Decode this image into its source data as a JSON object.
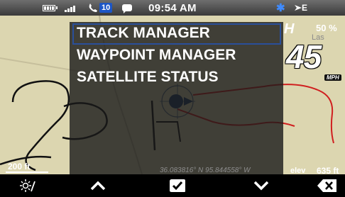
{
  "status_bar": {
    "battery_icon": "battery-icon",
    "signal_label": "atl",
    "missed_calls": "10",
    "time": "09:54 AM",
    "network": "E"
  },
  "menu": {
    "items": [
      "TRACK MANAGER",
      "WAYPOINT MANAGER",
      "SATELLITE STATUS"
    ],
    "selected_index": 0
  },
  "right_panel": {
    "heading": "H",
    "zoom": "50 %",
    "road_fragment": "Las",
    "speed": "45",
    "speed_unit": "MPH"
  },
  "info_bar": {
    "scale": "200 ft",
    "coordinates": "36.083816° N 95.844558° W",
    "elevation_label": "elev",
    "elevation_value": "635 ft"
  },
  "nav_bar": {
    "icons": [
      "day-night-icon",
      "chevron-up-icon",
      "checkmark-icon",
      "chevron-down-icon",
      "delete-icon"
    ]
  },
  "colors": {
    "map_background": "#dcd6b0",
    "track_line": "#d01f1f",
    "route_line": "#000000",
    "selection_outline": "#2a4f9a",
    "bluetooth": "#3f8bff",
    "call_badge": "#1d56c6"
  }
}
